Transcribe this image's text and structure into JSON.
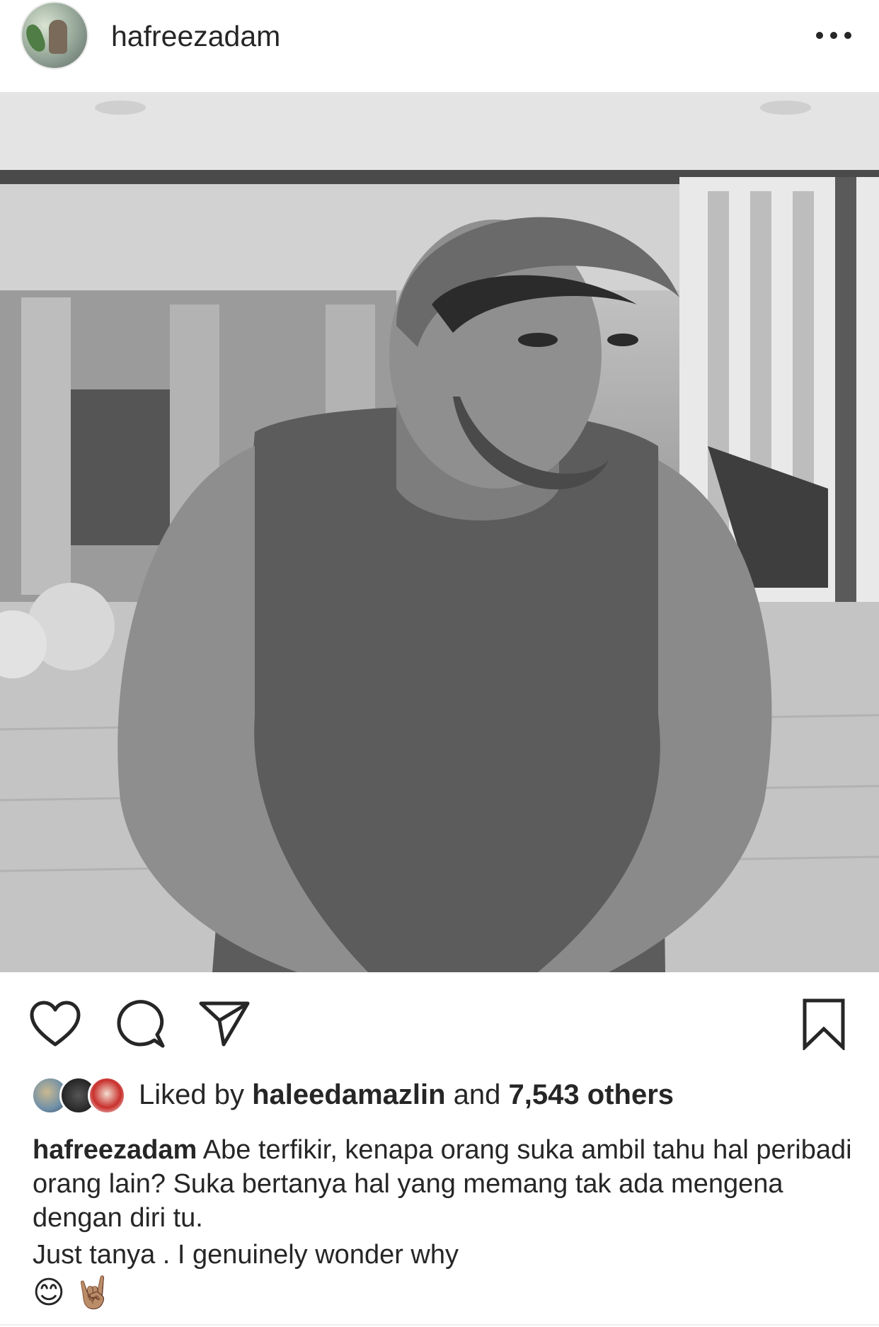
{
  "header": {
    "username": "hafreezadam",
    "more_icon": "more-horizontal-icon"
  },
  "post": {
    "photo_alt": "Black and white photo of a man in a beanie and sleeveless top sitting in a gym",
    "actions": {
      "like_icon": "heart-icon",
      "comment_icon": "comment-icon",
      "share_icon": "send-icon",
      "save_icon": "bookmark-icon"
    },
    "likes": {
      "prefix": "Liked by",
      "user": "haleedamazlin",
      "middle": "and",
      "count": "7,543 others"
    },
    "caption": {
      "user": "hafreezadam",
      "text": "Abe terfikir, kenapa orang suka ambil tahu hal peribadi orang lain? Suka bertanya hal yang memang tak ada mengena dengan diri tu.",
      "line2": "Just tanya . I genuinely wonder why",
      "emojis": "😊 🤘🏽"
    }
  },
  "colors": {
    "text": "#262626",
    "background": "#ffffff",
    "divider": "#efefef"
  }
}
